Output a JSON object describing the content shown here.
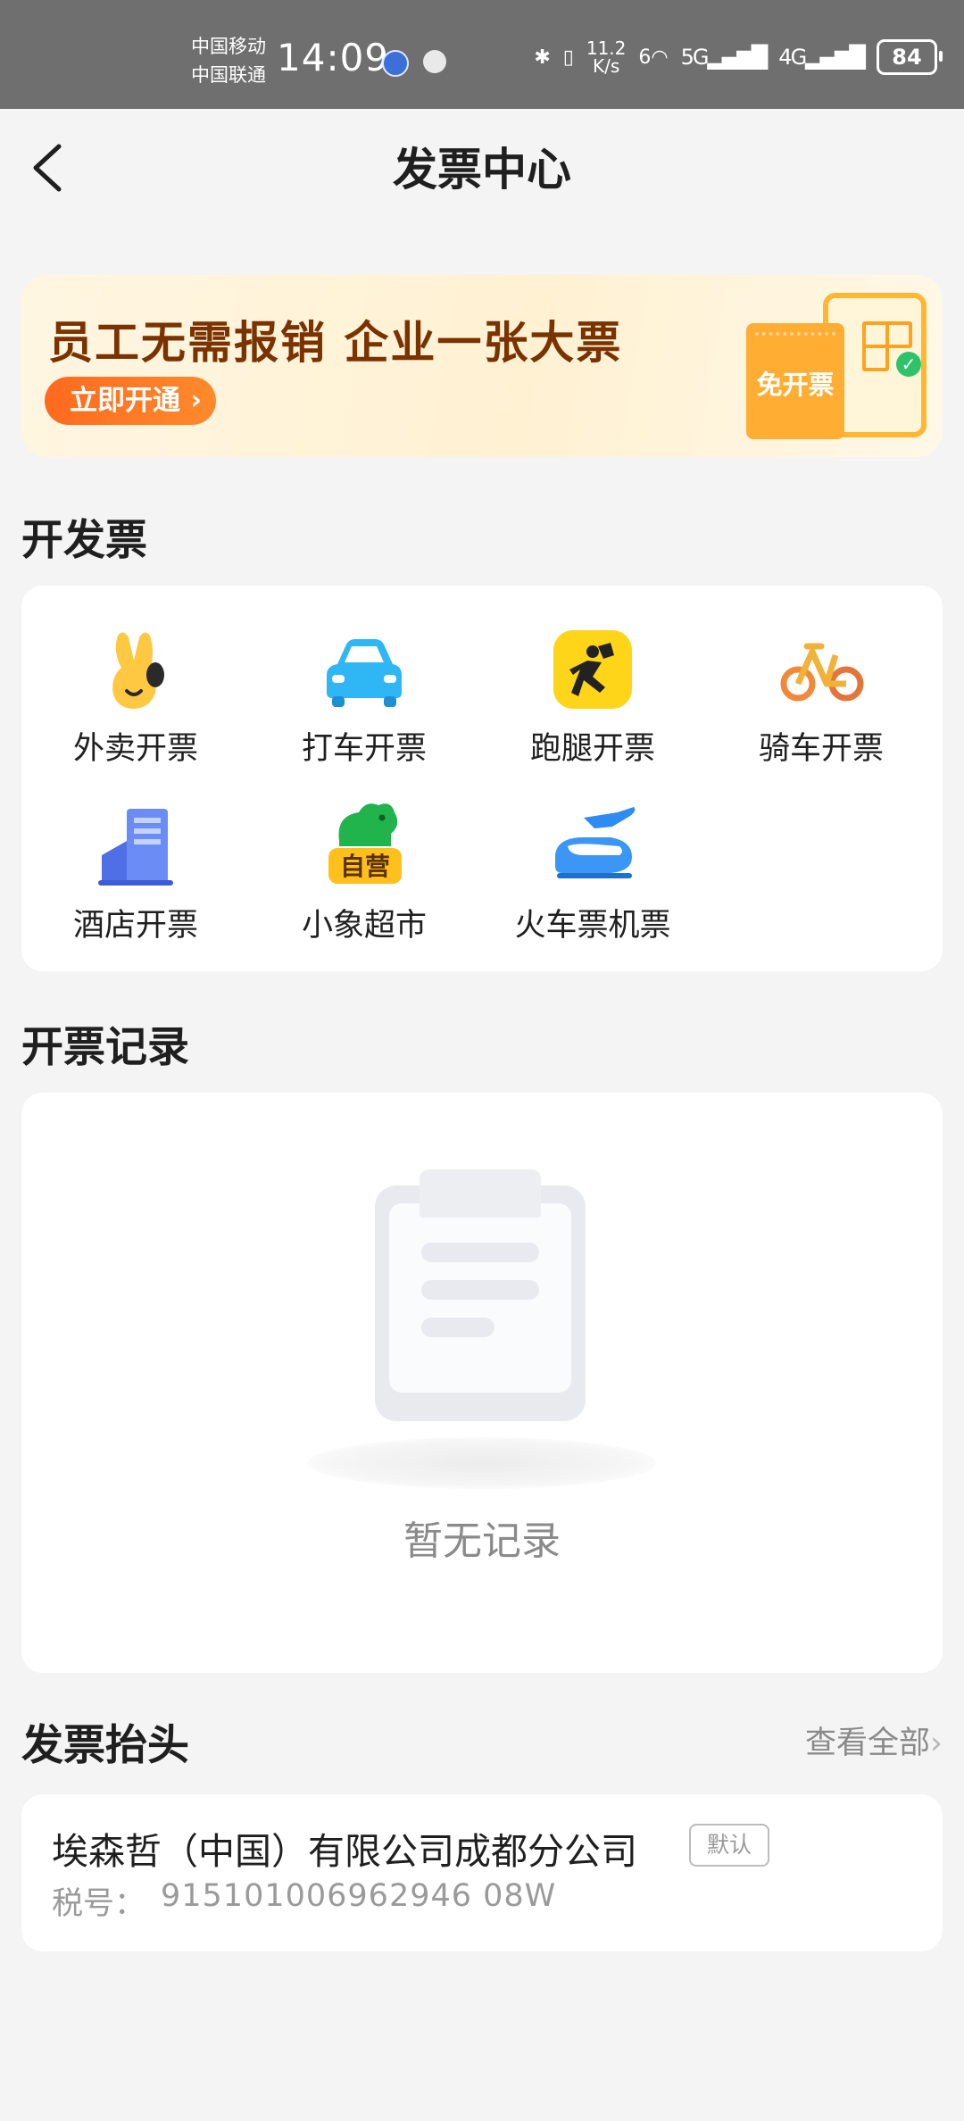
{
  "status_bar": {
    "carrier_1": "中国移动",
    "carrier_2": "中国联通",
    "time": "14:09",
    "net_speed_value": "11.2",
    "net_speed_unit": "K/s",
    "wifi_mark": "6",
    "net_1": "5G",
    "net_2": "4G",
    "battery": "84"
  },
  "header": {
    "title": "发票中心"
  },
  "banner": {
    "headline": "员工无需报销  企业一张大票",
    "cta_label": "立即开通",
    "ticket_label": "免开票"
  },
  "issue_section": {
    "title": "开发票",
    "items": [
      {
        "label": "外卖开票",
        "icon": "rabbit-icon"
      },
      {
        "label": "打车开票",
        "icon": "car-icon"
      },
      {
        "label": "跑腿开票",
        "icon": "runner-icon"
      },
      {
        "label": "骑车开票",
        "icon": "bicycle-icon"
      },
      {
        "label": "酒店开票",
        "icon": "hotel-icon"
      },
      {
        "label": "小象超市",
        "icon": "elephant-icon",
        "tag": "自营"
      },
      {
        "label": "火车票机票",
        "icon": "train-plane-icon"
      }
    ]
  },
  "records_section": {
    "title": "开票记录",
    "empty_text": "暂无记录"
  },
  "header_section": {
    "title": "发票抬头",
    "view_all": "查看全部",
    "company": "埃森哲（中国）有限公司成都分公司",
    "default_badge": "默认",
    "tax_label": "税号：",
    "tax_number": "915101006962946 08W"
  },
  "colors": {
    "accent_orange": "#ff6a1e",
    "banner_text": "#7a3300",
    "page_bg": "#f4f4f4"
  }
}
